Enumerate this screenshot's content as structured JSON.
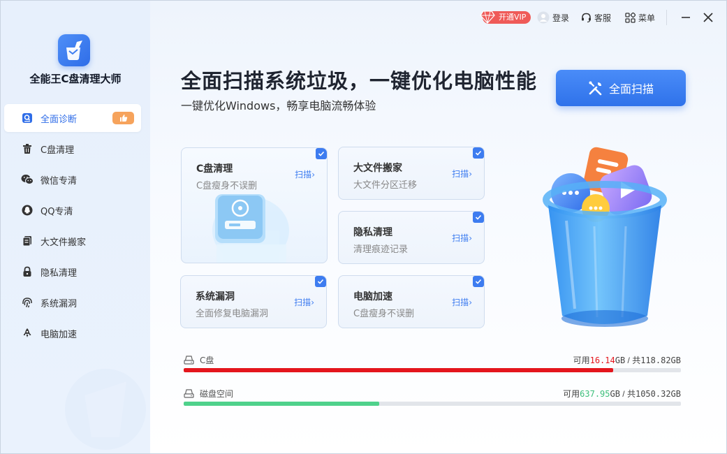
{
  "app": {
    "name": "全能王C盘清理大师"
  },
  "topbar": {
    "vip_label": "开通VIP",
    "login_label": "登录",
    "service_label": "客服",
    "menu_label": "菜单"
  },
  "sidebar": {
    "items": [
      {
        "label": "全面诊断",
        "icon": "search-doc-icon",
        "active": true
      },
      {
        "label": "C盘清理",
        "icon": "trash-icon"
      },
      {
        "label": "微信专清",
        "icon": "wechat-icon"
      },
      {
        "label": "QQ专清",
        "icon": "qq-icon"
      },
      {
        "label": "大文件搬家",
        "icon": "file-icon"
      },
      {
        "label": "隐私清理",
        "icon": "lock-icon"
      },
      {
        "label": "系统漏洞",
        "icon": "fingerprint-icon"
      },
      {
        "label": "电脑加速",
        "icon": "rocket-icon"
      }
    ]
  },
  "hero": {
    "title": "全面扫描系统垃圾，一键优化电脑性能",
    "subtitle": "一键优化Windows，畅享电脑流畅体验",
    "scan_button": "全面扫描"
  },
  "cards": [
    {
      "title": "C盘清理",
      "desc": "C盘瘦身不误删",
      "scan": "扫描",
      "checked": true
    },
    {
      "title": "大文件搬家",
      "desc": "大文件分区迁移",
      "scan": "扫描",
      "checked": true
    },
    {
      "title": "隐私清理",
      "desc": "清理痕迹记录",
      "scan": "扫描",
      "checked": true
    },
    {
      "title": "系统漏洞",
      "desc": "全面修复电脑漏洞",
      "scan": "扫描",
      "checked": true
    },
    {
      "title": "电脑加速",
      "desc": "C盘瘦身不误删",
      "scan": "扫描",
      "checked": true
    }
  ],
  "disks": [
    {
      "label": "C盘",
      "available_prefix": "可用",
      "available": "16.14",
      "unit1": "GB",
      "sep": " / 共",
      "total": "118.82GB",
      "used_fraction": 0.864,
      "color": "#e4161d",
      "avail_color": "#e4161d"
    },
    {
      "label": "磁盘空间",
      "available_prefix": "可用",
      "available": "637.95",
      "unit1": "GB",
      "sep": " / 共",
      "total": "1050.32GB",
      "used_fraction": 0.393,
      "color": "#4fd18b",
      "avail_color": "#3cbf7a"
    }
  ],
  "colors": {
    "accent": "#3d7cf0",
    "vip": "#ef5b58",
    "badge": "#f6a35c"
  }
}
